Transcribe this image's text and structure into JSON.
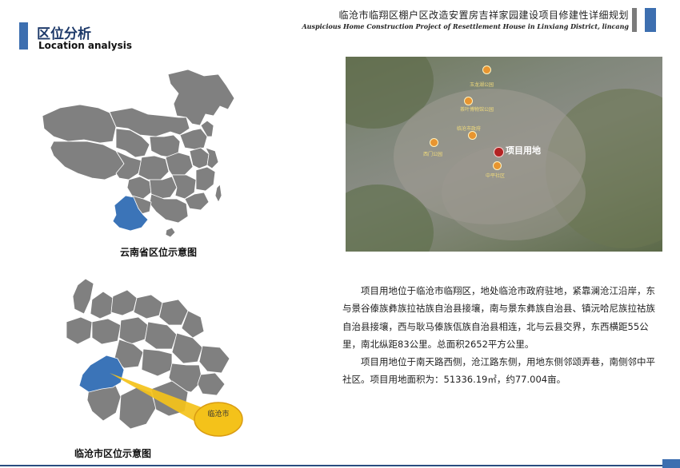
{
  "header": {
    "title": "区位分析",
    "subtitle": "Location analysis",
    "project_cn": "临沧市临翔区棚户区改造安置房吉祥家园建设项目修建性详细规划",
    "project_en": "Auspicious Home Construction Project of Resettlement House in Linxiang District, lincang"
  },
  "maps": {
    "china_caption": "云南省区位示意图",
    "yunnan_caption": "临沧市区位示意图",
    "callout_label": "临沧市"
  },
  "satellite": {
    "site_label": "项目用地",
    "pois": [
      "玉龙湖公园",
      "茶叶博物馆公园",
      "临沧市政府",
      "西门公园",
      "中平社区"
    ]
  },
  "description": {
    "paragraphs": [
      "项目用地位于临沧市临翔区，地处临沧市政府驻地，紧靠澜沧江沿岸，东与景谷傣族彝族拉祜族自治县接壤，南与景东彝族自治县、镇沅哈尼族拉祜族自治县接壤，西与耿马傣族佤族自治县相连，北与云县交界，东西横距55公里，南北纵距83公里。总面积2652平方公里。",
      "项目用地位于南天路西侧，沧江路东侧，用地东侧邻颂弄巷，南侧邻中平社区。项目用地面积为：51336.19㎡，约77.004亩。"
    ]
  },
  "colors": {
    "accent": "#3d6fb0",
    "map_gray": "#808080",
    "highlight": "#3b74b8",
    "callout": "#f4c21a"
  }
}
